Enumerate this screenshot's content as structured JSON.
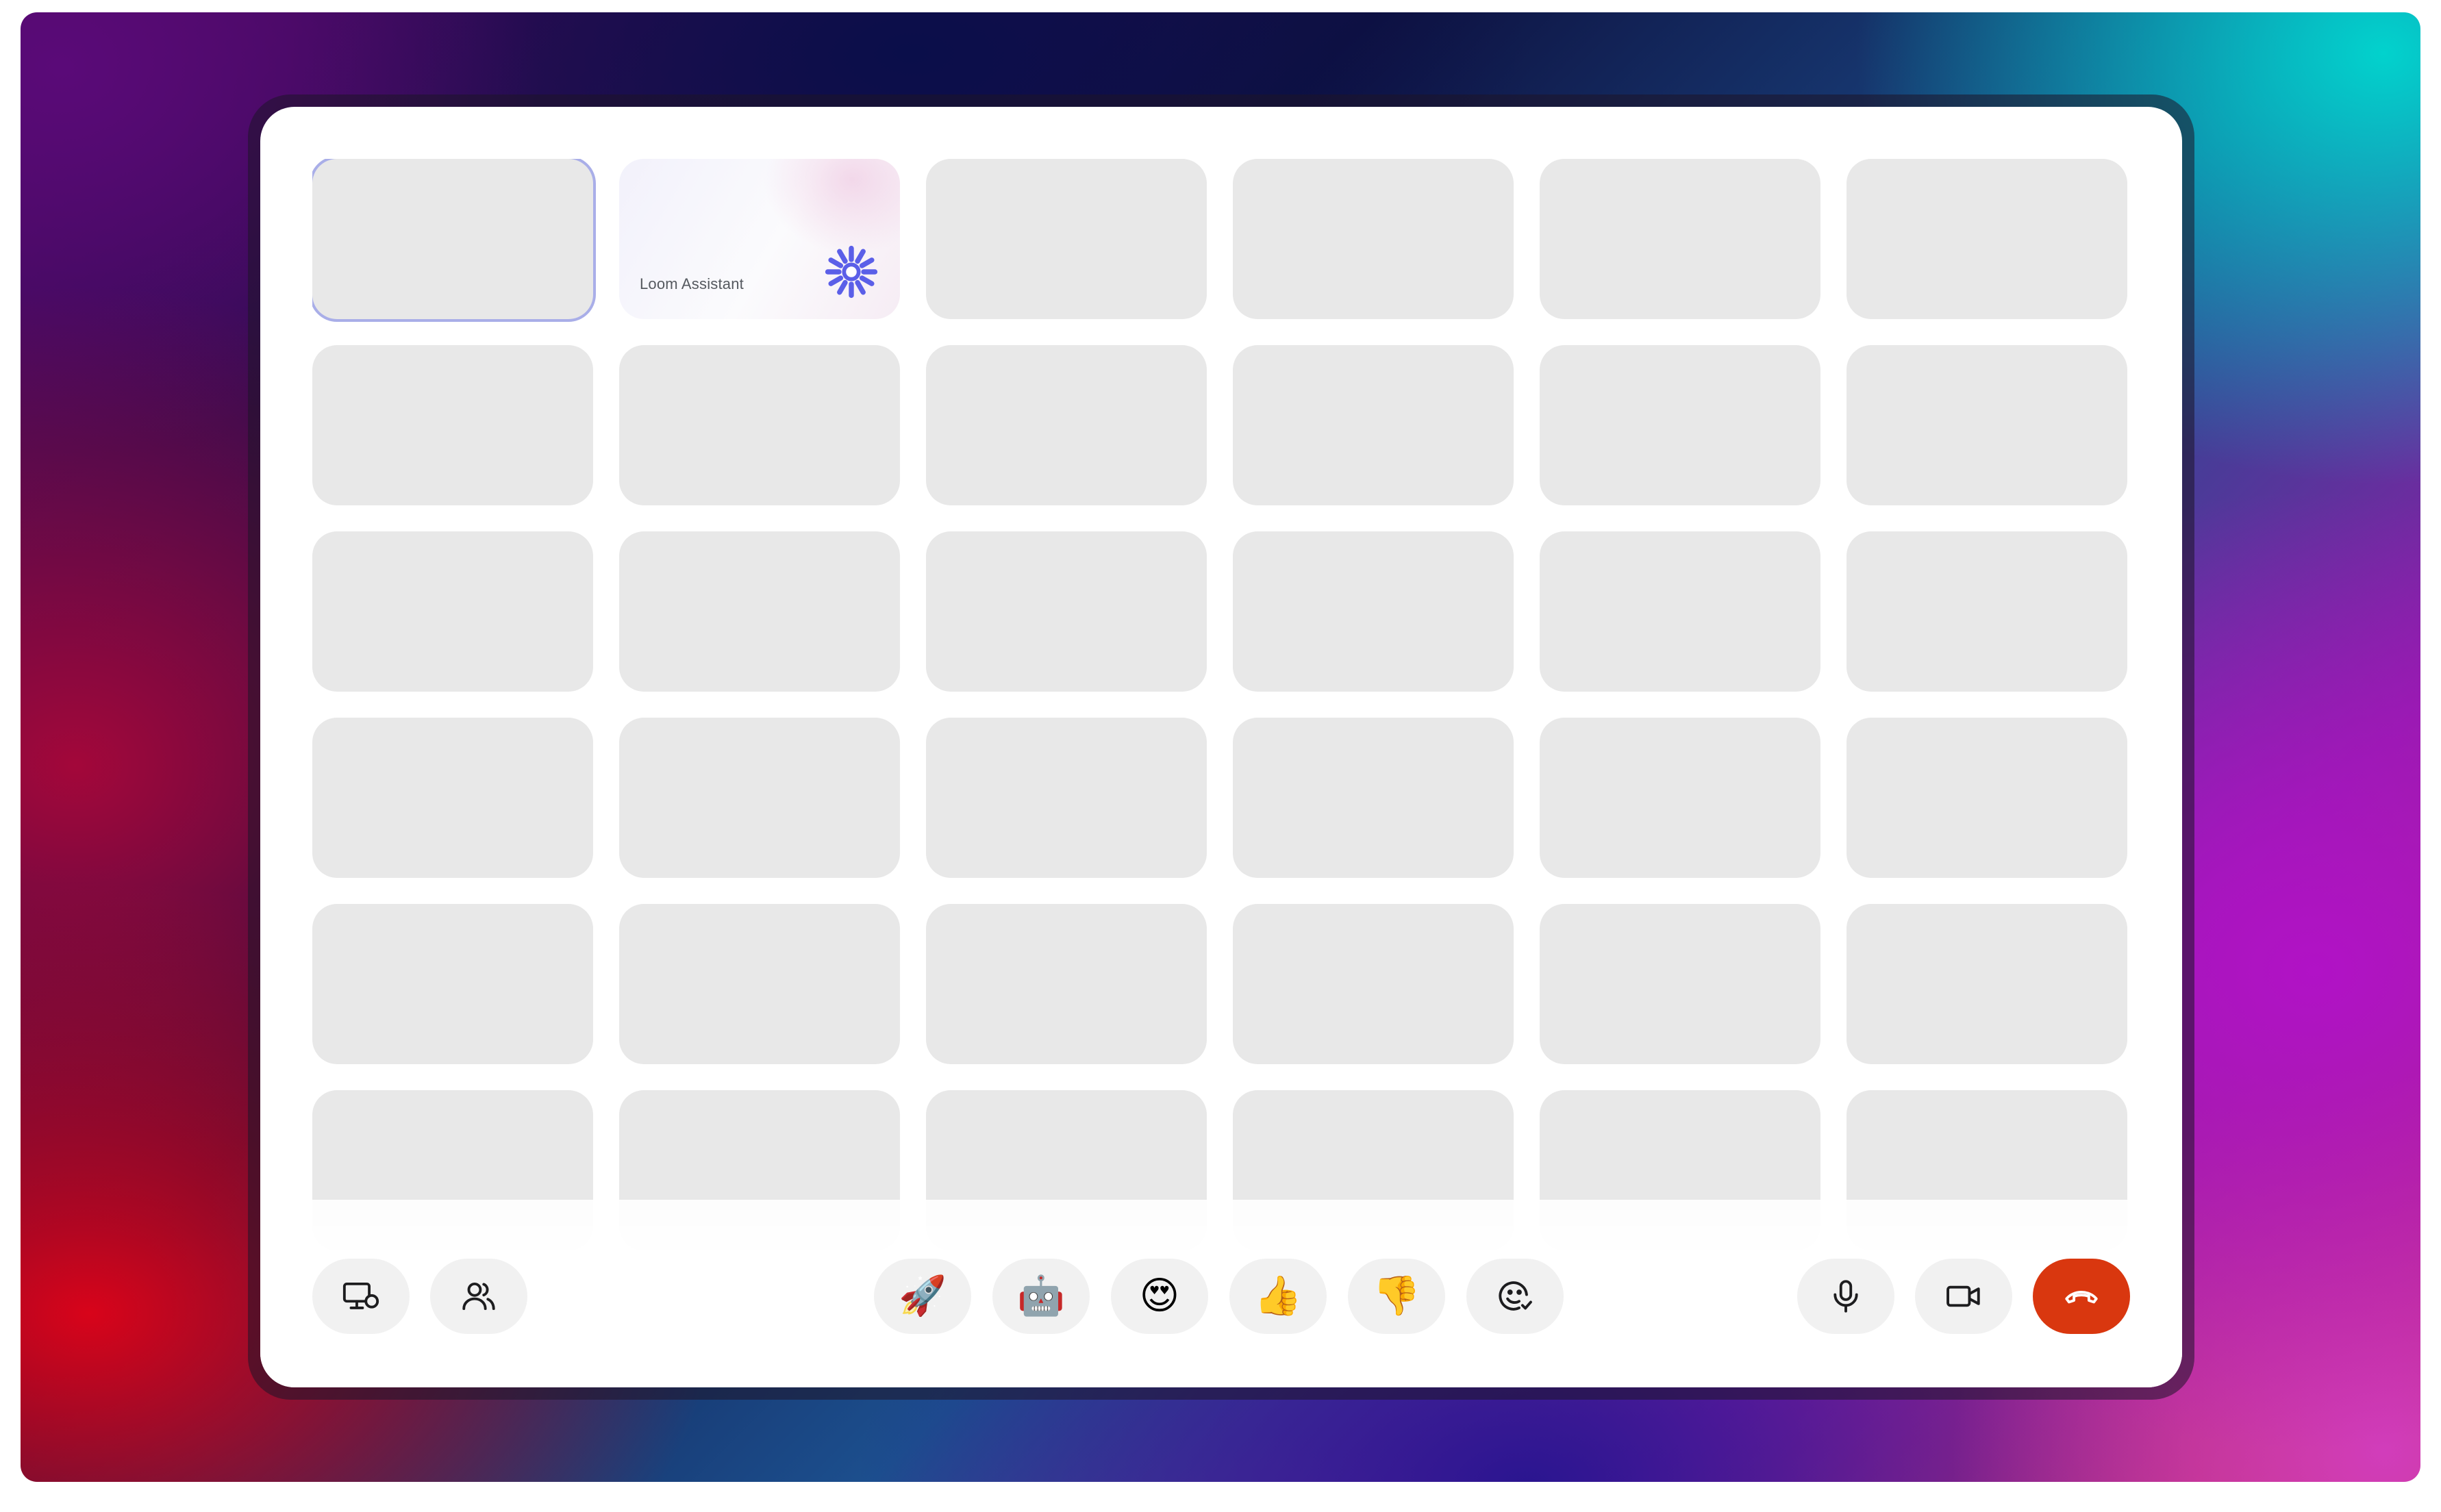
{
  "grid": {
    "rows": 6,
    "columns": 6,
    "assistant_tile": {
      "label": "Loom Assistant",
      "icon": "loom-burst-icon",
      "accent_color": "#5b5fe8"
    },
    "selected_tile_border_color": "#a9aee8",
    "tile_color": "#e8e8e8"
  },
  "toolbar": {
    "left": [
      {
        "name": "screen-share-button",
        "icon": "monitor-icon"
      },
      {
        "name": "participants-button",
        "icon": "people-icon"
      }
    ],
    "reactions": [
      {
        "name": "reaction-rocket-button",
        "emoji": "🚀"
      },
      {
        "name": "reaction-robot-button",
        "emoji": "🤖"
      },
      {
        "name": "reaction-heart-eyes-button",
        "emoji": "😍"
      },
      {
        "name": "reaction-thumbs-up-button",
        "emoji": "👍"
      },
      {
        "name": "reaction-thumbs-down-button",
        "emoji": "👎"
      },
      {
        "name": "add-reaction-button",
        "icon": "emoji-picker-icon"
      }
    ],
    "right": [
      {
        "name": "microphone-button",
        "icon": "microphone-icon"
      },
      {
        "name": "camera-button",
        "icon": "video-camera-icon"
      },
      {
        "name": "end-call-button",
        "icon": "hang-up-icon",
        "color": "#d9370f"
      }
    ]
  }
}
